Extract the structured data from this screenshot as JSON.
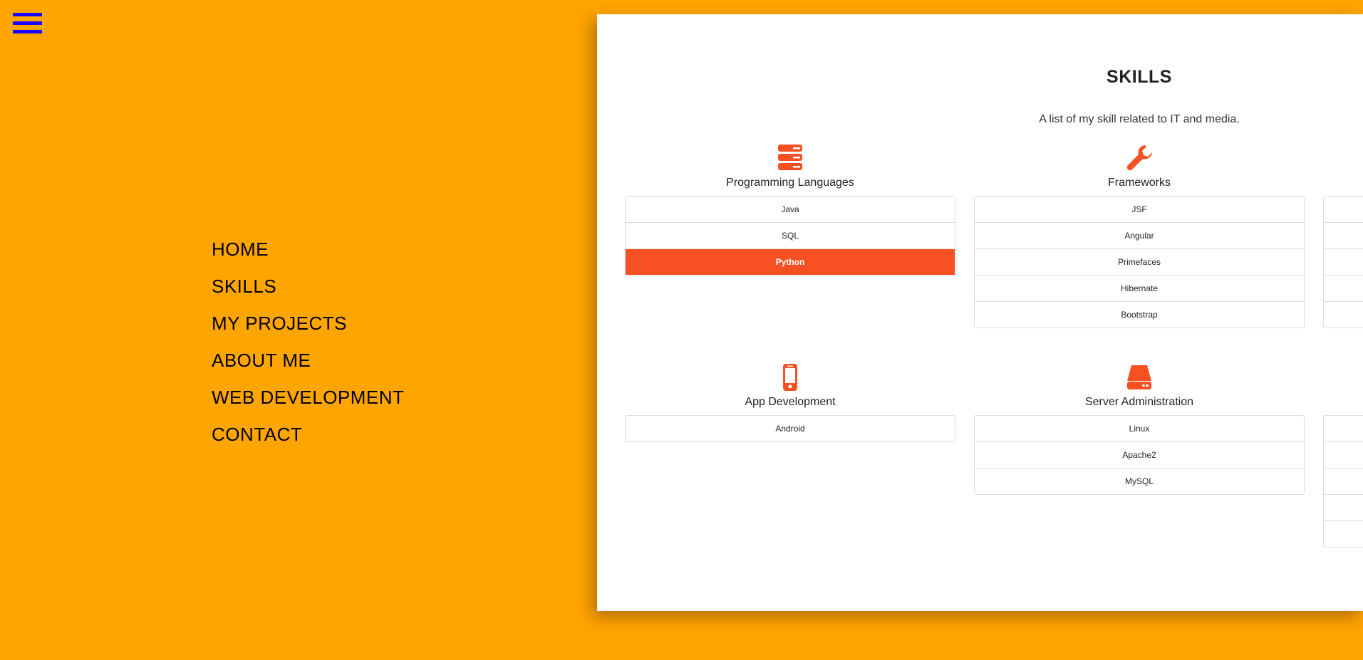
{
  "menu_icon": "hamburger-menu-icon",
  "nav": {
    "items": [
      {
        "label": "HOME"
      },
      {
        "label": "SKILLS"
      },
      {
        "label": "MY PROJECTS"
      },
      {
        "label": "ABOUT ME"
      },
      {
        "label": "WEB DEVELOPMENT"
      },
      {
        "label": "CONTACT"
      }
    ]
  },
  "skills": {
    "title": "SKILLS",
    "subtitle": "A list of my skill related to IT and media.",
    "groups": [
      {
        "title": "Programming Languages",
        "icon": "server-stack-icon",
        "items": [
          "Java",
          "SQL",
          "Python"
        ],
        "active_item": "Python"
      },
      {
        "title": "Frameworks",
        "icon": "wrench-icon",
        "items": [
          "JSF",
          "Angular",
          "Primefaces",
          "Hibernate",
          "Bootstrap"
        ]
      },
      {
        "title": "App Development",
        "icon": "mobile-phone-icon",
        "items": [
          "Android"
        ]
      },
      {
        "title": "Server Administration",
        "icon": "hard-drive-icon",
        "items": [
          "Linux",
          "Apache2",
          "MySQL"
        ]
      }
    ]
  },
  "colors": {
    "background": "#FFA500",
    "accent": "#F75123",
    "menu_icon": "#1a00ff",
    "panel": "#FFFFFF"
  }
}
